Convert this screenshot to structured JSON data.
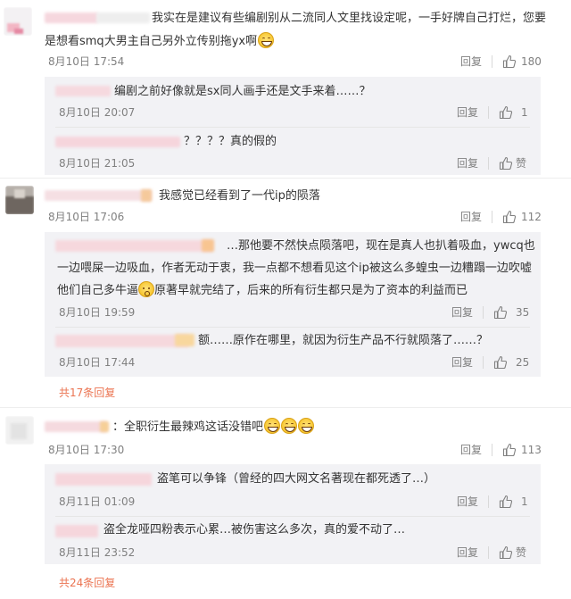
{
  "comments": [
    {
      "text_line1": "我实在是建议有些编剧别从二流同人文里找设定呢，一手好牌自己打烂，您要",
      "text_line2": "是想看smq大男主自己另外立传别拖yx啊",
      "time": "8月10日 17:54",
      "reply": "回复",
      "likes": "180",
      "replies": [
        {
          "text": "编剧之前好像就是sx同人画手还是文手来着……？",
          "time": "8月10日 20:07",
          "reply": "回复",
          "likes": "1"
        },
        {
          "text": "？？？？真的假的",
          "time": "8月10日 21:05",
          "reply": "回复",
          "likes": "赞"
        }
      ]
    },
    {
      "text_line1": "我感觉已经看到了一代ip的陨落",
      "time": "8月10日 17:06",
      "reply": "回复",
      "likes": "112",
      "replies": [
        {
          "text_line1": "…那他要不然快点陨落吧，现在是真人也扒着吸血，ywcq也",
          "text_line2": "一边喂屎一边吸血，作者无动于衷，我一点都不想看见这个ip被这么多蝗虫一边糟蹋一边吹嘘",
          "text_line3a": "他们自己多牛逼",
          "text_line3b": "原著早就完结了，后来的所有衍生都只是为了资本的利益而已",
          "time": "8月10日 19:59",
          "reply": "回复",
          "likes": "35"
        },
        {
          "text": "额……原作在哪里，就因为衍生产品不行就陨落了……？",
          "time": "8月10日 17:44",
          "reply": "回复",
          "likes": "25"
        }
      ],
      "more": "共17条回复"
    },
    {
      "text_line1": "：全职衍生最辣鸡这话没错吧",
      "time": "8月10日 17:30",
      "reply": "回复",
      "likes": "113",
      "replies": [
        {
          "text": "盗笔可以争锋（曾经的四大网文名著现在都死透了…）",
          "time": "8月11日 01:09",
          "reply": "回复",
          "likes": "1"
        },
        {
          "text": "盗全龙哑四粉表示心累…被伤害这么多次，真的爱不动了…",
          "time": "8月11日 23:52",
          "reply": "回复",
          "likes": "赞"
        }
      ],
      "more": "共24条回复"
    }
  ],
  "icons": {
    "like": "thumbs-up-icon",
    "emoji_grin": "grin-emoji-icon",
    "emoji_shock": "surprised-emoji-icon"
  },
  "colors": {
    "accent": "#eb7350",
    "meta": "#808080",
    "subbg": "#f2f2f5"
  }
}
